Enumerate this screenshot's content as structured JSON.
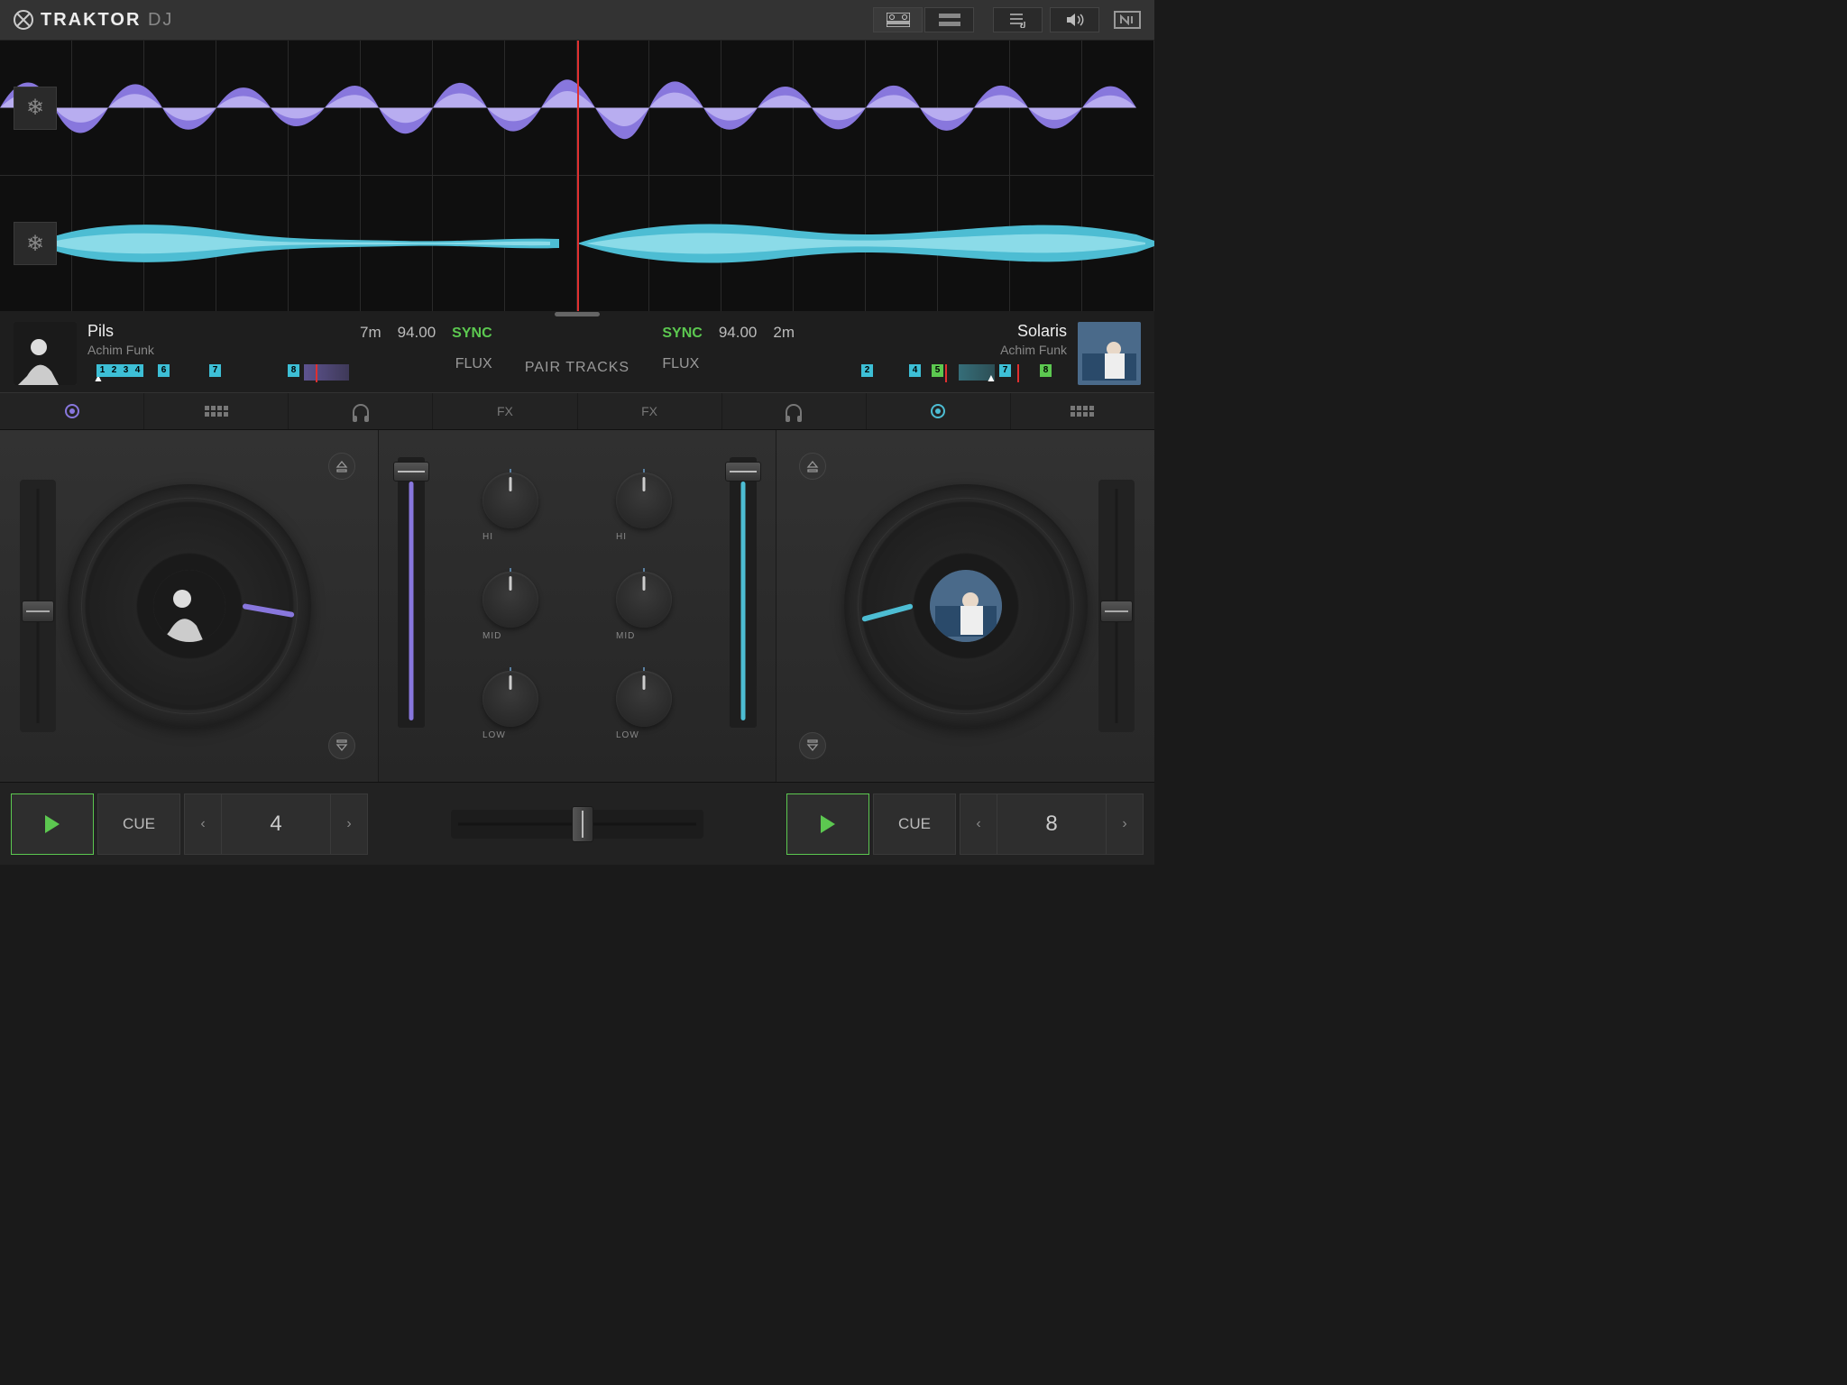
{
  "app": {
    "name_bold": "TRAKTOR",
    "name_light": "DJ"
  },
  "labels": {
    "sync": "SYNC",
    "flux": "FLUX",
    "pair": "PAIR TRACKS",
    "fx": "FX",
    "cue": "CUE",
    "hi": "HI",
    "mid": "MID",
    "low": "LOW"
  },
  "deck_a": {
    "title": "Pils",
    "artist": "Achim Funk",
    "remaining": "7m",
    "bpm": "94.00",
    "loop": "4",
    "cues": [
      {
        "n": "1",
        "color": "blue",
        "pos": 10
      },
      {
        "n": "2",
        "color": "blue",
        "pos": 23
      },
      {
        "n": "3",
        "color": "blue",
        "pos": 36
      },
      {
        "n": "4",
        "color": "blue",
        "pos": 49
      },
      {
        "n": "6",
        "color": "blue",
        "pos": 78
      },
      {
        "n": "7",
        "color": "blue",
        "pos": 135
      },
      {
        "n": "8",
        "color": "blue",
        "pos": 222
      }
    ]
  },
  "deck_b": {
    "title": "Solaris",
    "artist": "Achim Funk",
    "remaining": "2m",
    "bpm": "94.00",
    "loop": "8",
    "cues": [
      {
        "n": "2",
        "color": "blue",
        "pos": 62
      },
      {
        "n": "4",
        "color": "blue",
        "pos": 115
      },
      {
        "n": "5",
        "color": "green",
        "pos": 140
      },
      {
        "n": "7",
        "color": "blue",
        "pos": 215
      },
      {
        "n": "8",
        "color": "green",
        "pos": 260
      }
    ]
  },
  "colors": {
    "deck_a": "#8877dd",
    "deck_b": "#4dbdd3",
    "accent": "#5cc850",
    "playhead": "#e03030"
  }
}
